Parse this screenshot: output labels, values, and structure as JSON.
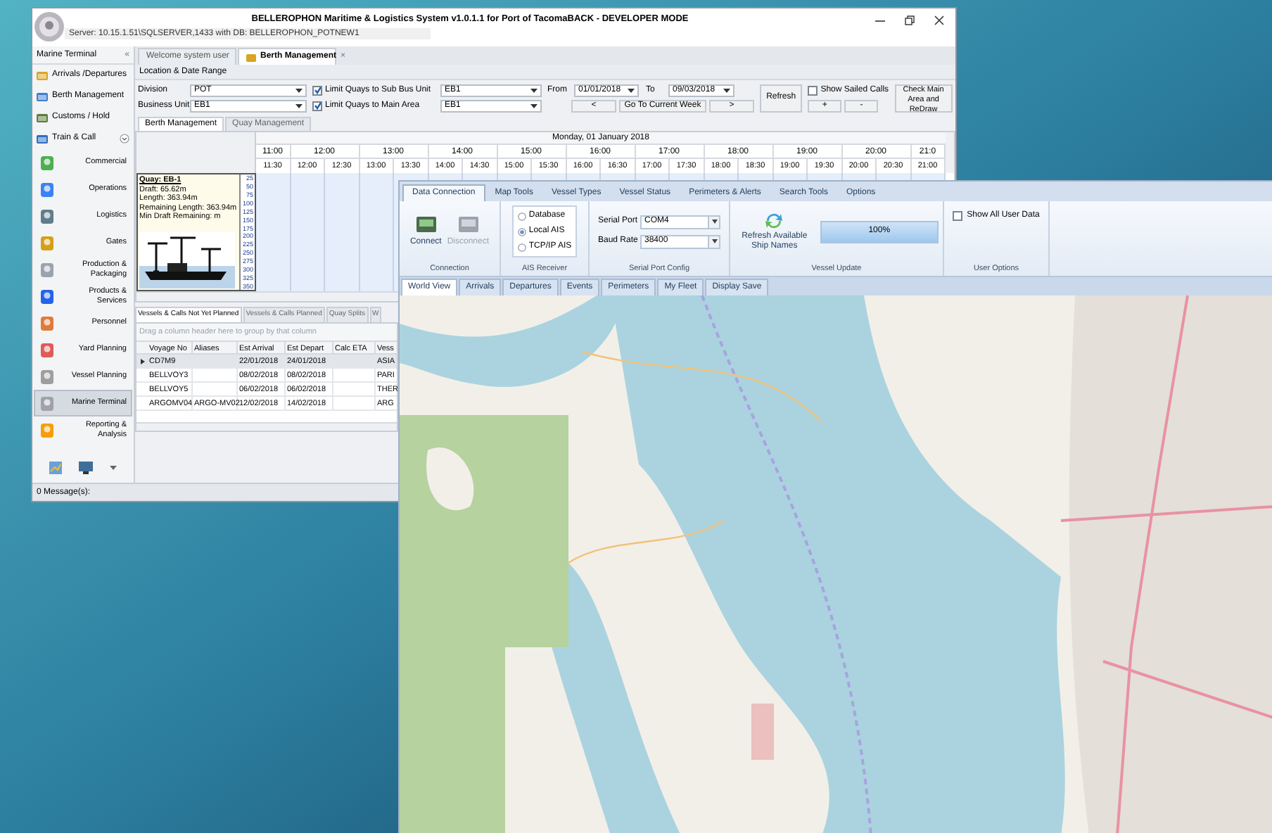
{
  "main_window": {
    "title": "BELLEROPHON Maritime & Logistics System v1.0.1.1 for Port of TacomaBACK - DEVELOPER MODE",
    "server": "Server: 10.15.1.51\\SQLSERVER,1433 with DB: BELLEROPHON_POTNEW1",
    "sidebar": {
      "title": "Marine Terminal",
      "collapse": "«",
      "links": [
        {
          "label": "Arrivals /Departures"
        },
        {
          "label": "Berth Management"
        },
        {
          "label": "Customs / Hold"
        },
        {
          "label": "Train & Call",
          "expandable": true
        }
      ],
      "modules": [
        {
          "label": "Commercial",
          "selected": false
        },
        {
          "label": "Operations",
          "selected": false
        },
        {
          "label": "Logistics",
          "selected": false
        },
        {
          "label": "Gates",
          "selected": false
        },
        {
          "label": "Production & Packaging",
          "selected": false
        },
        {
          "label": "Products & Services",
          "selected": false
        },
        {
          "label": "Personnel",
          "selected": false
        },
        {
          "label": "Yard Planning",
          "selected": false
        },
        {
          "label": "Vessel Planning",
          "selected": false
        },
        {
          "label": "Marine Terminal",
          "selected": true
        },
        {
          "label": "Reporting & Analysis",
          "selected": false
        }
      ]
    },
    "tabs": [
      {
        "label": "Welcome system user",
        "selected": false
      },
      {
        "label": "Berth Management",
        "selected": true,
        "close": "×"
      }
    ],
    "filters": {
      "section": "Location & Date Range",
      "division": {
        "label": "Division",
        "value": "POT"
      },
      "business_unit": {
        "label": "Business Unit",
        "value": "EB1"
      },
      "limit_sub": {
        "label": "Limit Quays to Sub Bus Unit",
        "checked": true,
        "value": "EB1"
      },
      "limit_main": {
        "label": "Limit Quays to Main Area",
        "checked": true,
        "value": "EB1"
      },
      "from": {
        "label": "From",
        "value": "01/01/2018"
      },
      "to": {
        "label": "To",
        "value": "09/03/2018"
      },
      "prev": "<",
      "current_week": "Go To Current Week",
      "next": ">",
      "refresh": "Refresh",
      "show_sailed": {
        "label": "Show Sailed Calls",
        "checked": false
      },
      "plus": "+",
      "minus": "-",
      "redraw": "Check Main Area and ReDraw"
    },
    "subtabs": [
      {
        "label": "Berth Management",
        "selected": true
      },
      {
        "label": "Quay Management",
        "selected": false
      }
    ],
    "schedule": {
      "date": "Monday, 01 January 2018",
      "hours": [
        "11:00",
        "12:00",
        "13:00",
        "14:00",
        "15:00",
        "16:00",
        "17:00",
        "18:00",
        "19:00",
        "20:00",
        "21:0"
      ],
      "slots": [
        "11:30",
        "12:00",
        "12:30",
        "13:00",
        "13:30",
        "14:00",
        "14:30",
        "15:00",
        "15:30",
        "16:00",
        "16:30",
        "17:00",
        "17:30",
        "18:00",
        "18:30",
        "19:00",
        "19:30",
        "20:00",
        "20:30",
        "21:00"
      ]
    },
    "quay": {
      "title": "Quay: EB-1",
      "lines": [
        "Draft: 65.62m",
        "Length: 363.94m",
        "Remaining Length: 363.94m",
        "Min Draft Remaining: m"
      ],
      "ruler": [
        "25",
        "50",
        "75",
        "100",
        "125",
        "150",
        "175",
        "200",
        "225",
        "250",
        "275",
        "300",
        "325",
        "350"
      ]
    },
    "bottom_tabs": [
      {
        "label": "Vessels & Calls Not Yet Planned",
        "selected": true
      },
      {
        "label": "Vessels & Calls Planned",
        "selected": false
      },
      {
        "label": "Quay Splits",
        "selected": false
      },
      {
        "label": "W",
        "selected": false
      }
    ],
    "group_hint": "Drag a column header here to group by that column",
    "table": {
      "columns": [
        "Voyage No",
        "Aliases",
        "Est Arrival",
        "Est Depart",
        "Calc ETA",
        "Vess"
      ],
      "rows": [
        {
          "current": true,
          "cells": [
            "CD7M9",
            "",
            "22/01/2018",
            "24/01/2018",
            "",
            "ASIA"
          ]
        },
        {
          "current": false,
          "cells": [
            "BELLVOY3",
            "",
            "08/02/2018",
            "08/02/2018",
            "",
            "PARI"
          ]
        },
        {
          "current": false,
          "cells": [
            "BELLVOY5",
            "",
            "06/02/2018",
            "06/02/2018",
            "",
            "THER"
          ]
        },
        {
          "current": false,
          "cells": [
            "ARGOMV04",
            "ARGO-MV02",
            "12/02/2018",
            "14/02/2018",
            "",
            "ARG"
          ]
        }
      ]
    },
    "status": "0 Message(s):"
  },
  "ais_window": {
    "ribbon_tabs": [
      {
        "label": "Data Connection",
        "selected": true
      },
      {
        "label": "Map Tools",
        "selected": false
      },
      {
        "label": "Vessel Types",
        "selected": false
      },
      {
        "label": "Vessel Status",
        "selected": false
      },
      {
        "label": "Perimeters & Alerts",
        "selected": false
      },
      {
        "label": "Search Tools",
        "selected": false
      },
      {
        "label": "Options",
        "selected": false
      }
    ],
    "groups": [
      {
        "kind": "connection",
        "label": "Connection",
        "buttons": [
          {
            "label": "Connect",
            "disabled": false
          },
          {
            "label": "Disconnect",
            "disabled": true
          }
        ]
      },
      {
        "kind": "radios",
        "label": "AIS Receiver",
        "options": [
          {
            "label": "Database",
            "selected": false
          },
          {
            "label": "Local AIS",
            "selected": true
          },
          {
            "label": "TCP/IP AIS",
            "selected": false
          }
        ]
      },
      {
        "kind": "serial",
        "label": "Serial Port Config",
        "fields": [
          {
            "label": "Serial Port",
            "value": "COM4"
          },
          {
            "label": "Baud Rate",
            "value": "38400"
          }
        ]
      },
      {
        "kind": "update",
        "label": "Vessel Update",
        "button": "Refresh Available Ship Names",
        "progress": {
          "level": 1,
          "text": "100%"
        }
      },
      {
        "kind": "options",
        "label": "User Options",
        "checkbox": {
          "label": "Show All User Data",
          "checked": false
        }
      }
    ],
    "view_tabs": [
      {
        "label": "World View",
        "selected": true
      },
      {
        "label": "Arrivals",
        "selected": false
      },
      {
        "label": "Departures",
        "selected": false
      },
      {
        "label": "Events",
        "selected": false
      },
      {
        "label": "Perimeters",
        "selected": false
      },
      {
        "label": "My Fleet",
        "selected": false
      },
      {
        "label": "Display Save",
        "selected": false
      }
    ]
  }
}
